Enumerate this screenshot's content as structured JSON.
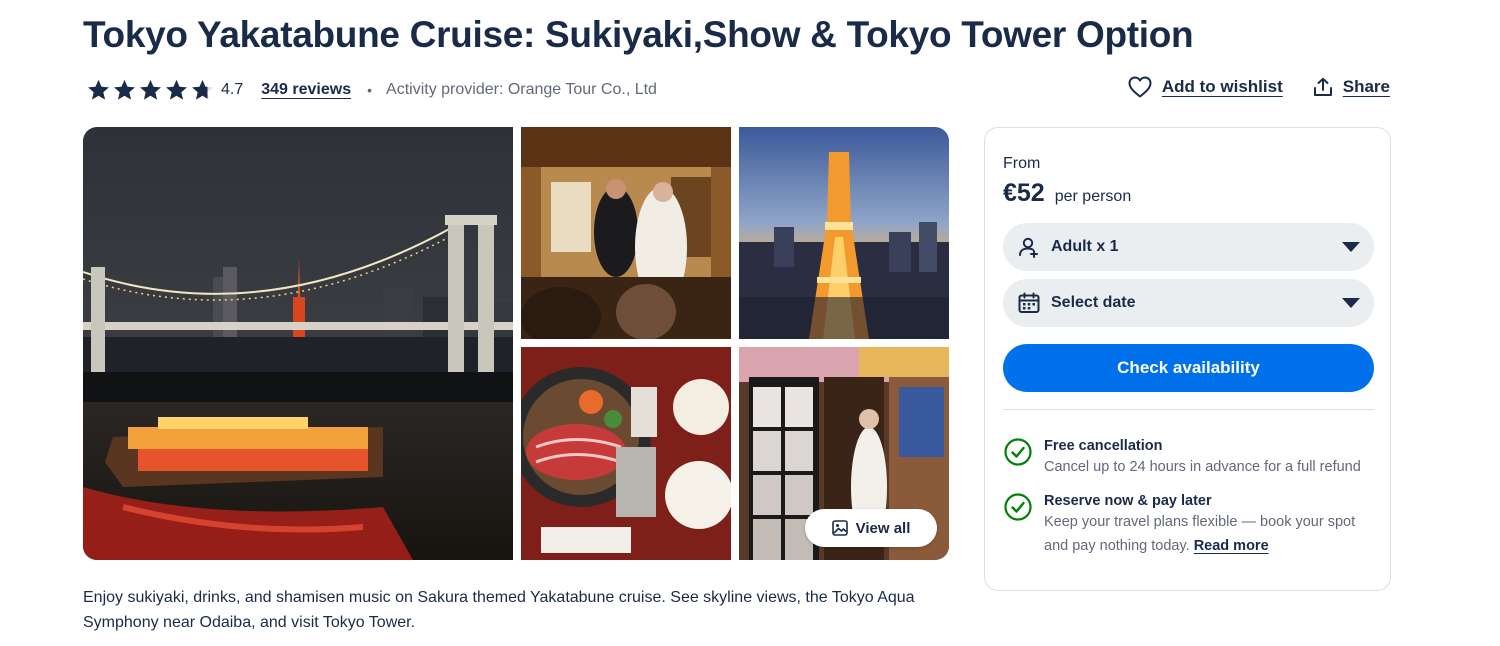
{
  "header": {
    "title": "Tokyo Yakatabune Cruise: Sukiyaki,Show & Tokyo Tower Option",
    "rating": "4.7",
    "rating_value": 4.7,
    "reviews": "349 reviews",
    "separator": "•",
    "provider": "Activity provider: Orange Tour Co., Ltd",
    "wishlist_label": "Add to wishlist",
    "share_label": "Share"
  },
  "gallery": {
    "view_all_label": "View all"
  },
  "description": "Enjoy sukiyaki, drinks, and shamisen music on Sakura themed Yakatabune cruise. See skyline views, the Tokyo Aqua Symphony near Odaiba, and visit Tokyo Tower.",
  "booking": {
    "from_label": "From",
    "price": "€52",
    "per_label": "per person",
    "participants": "Adult x 1",
    "date_placeholder": "Select date",
    "cta_label": "Check availability",
    "perks": [
      {
        "title": "Free cancellation",
        "body": "Cancel up to 24 hours in advance for a full refund"
      },
      {
        "title": "Reserve now & pay later",
        "body": "Keep your travel plans flexible — book your spot and pay nothing today.",
        "link": "Read more"
      }
    ]
  },
  "colors": {
    "text": "#1a2b49",
    "muted": "#63687a",
    "primary": "#0071eb",
    "check": "#008009",
    "pill_bg": "#ebeef1"
  },
  "icons": [
    "star-icon",
    "heart-icon",
    "share-icon",
    "image-icon",
    "user-icon",
    "calendar-icon",
    "caret-down-icon",
    "check-circle-icon"
  ]
}
